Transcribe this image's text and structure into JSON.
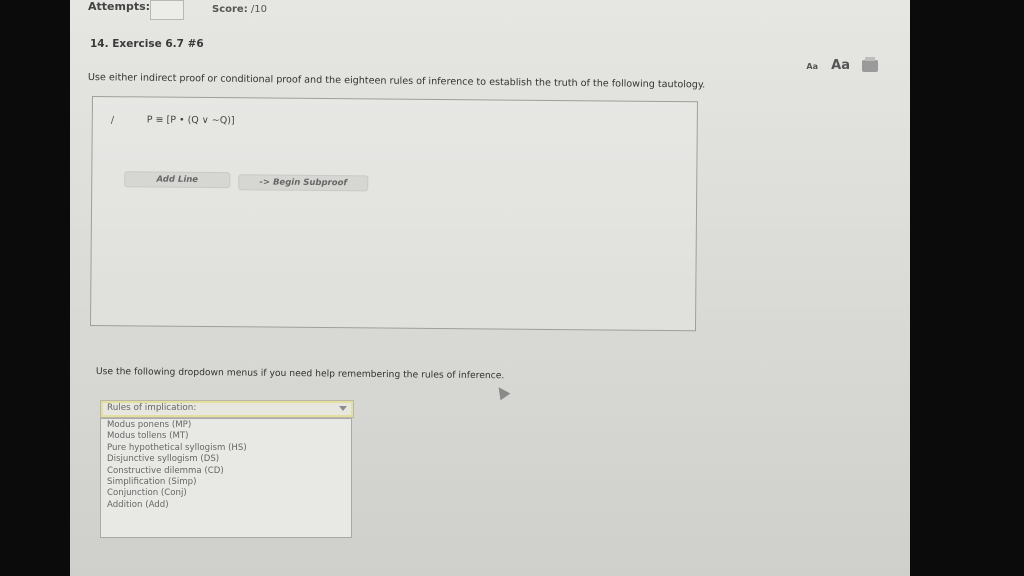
{
  "header": {
    "attempts_label": "Attempts:",
    "score_label": "Score:",
    "score_value": "/10"
  },
  "exercise": {
    "title": "14. Exercise 6.7 #6",
    "instructions": "Use either indirect proof or conditional proof and the eighteen rules of inference to establish the truth of the following tautology.",
    "text_tools": {
      "aa_small": "Aa",
      "aa_large": "Aa",
      "print_icon": "print-icon"
    }
  },
  "proof": {
    "row_symbol": "/",
    "premise": "P ≡ [P • (Q ∨ ~Q)]",
    "buttons": {
      "add_line": "Add Line",
      "begin_subproof": "-> Begin Subproof"
    }
  },
  "help": {
    "text": "Use the following dropdown menus if you need help remembering the rules of inference.",
    "dropdown": {
      "selected": "Rules of implication:",
      "options": [
        "Modus ponens (MP)",
        "Modus tollens (MT)",
        "Pure hypothetical syllogism (HS)",
        "Disjunctive syllogism (DS)",
        "Constructive dilemma (CD)",
        "Simplification (Simp)",
        "Conjunction (Conj)",
        "Addition (Add)"
      ]
    }
  }
}
